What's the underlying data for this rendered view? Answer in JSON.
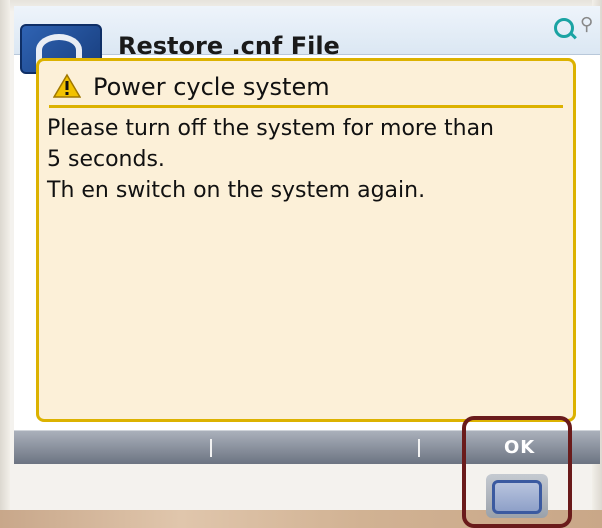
{
  "window": {
    "title": "Restore .cnf File"
  },
  "icons": {
    "app": "restore-app-icon",
    "search": "search-icon",
    "user": "user-icon",
    "warning": "warning-icon"
  },
  "dialog": {
    "title": "Power cycle system",
    "lines": [
      "Please turn off the system for more than",
      "5 seconds.",
      "Th en switch on the system again."
    ]
  },
  "softkeys": {
    "ok_label": "OK"
  },
  "colors": {
    "dialog_background": "#fcf0d8",
    "dialog_border": "#dcb200",
    "softkey_bar": "#7d8592",
    "highlight": "#6a1b1b",
    "hard_key_ring": "#3b5aa0"
  }
}
